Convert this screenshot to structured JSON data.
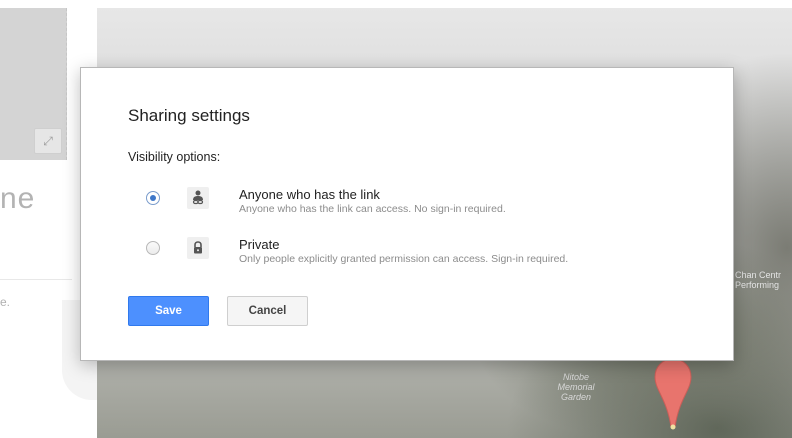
{
  "background": {
    "partial_title": "ne",
    "partial_text": "e.",
    "expand_icon": "expand-icon",
    "map_labels": {
      "garden": [
        "Nitobe",
        "Memorial",
        "Garden"
      ],
      "right": [
        "Chan Centr",
        "Performing"
      ]
    }
  },
  "dialog": {
    "title": "Sharing settings",
    "visibility_label": "Visibility options:",
    "options": [
      {
        "title": "Anyone who has the link",
        "description": "Anyone who has the link can access. No sign-in required.",
        "icon": "person-link-icon",
        "selected": true
      },
      {
        "title": "Private",
        "description": "Only people explicitly granted permission can access. Sign-in required.",
        "icon": "lock-icon",
        "selected": false
      }
    ],
    "save_label": "Save",
    "cancel_label": "Cancel"
  },
  "colors": {
    "primary_button": "#4d90fe",
    "radio_selected": "#3e77c9",
    "map_pin": "#e8746d"
  }
}
